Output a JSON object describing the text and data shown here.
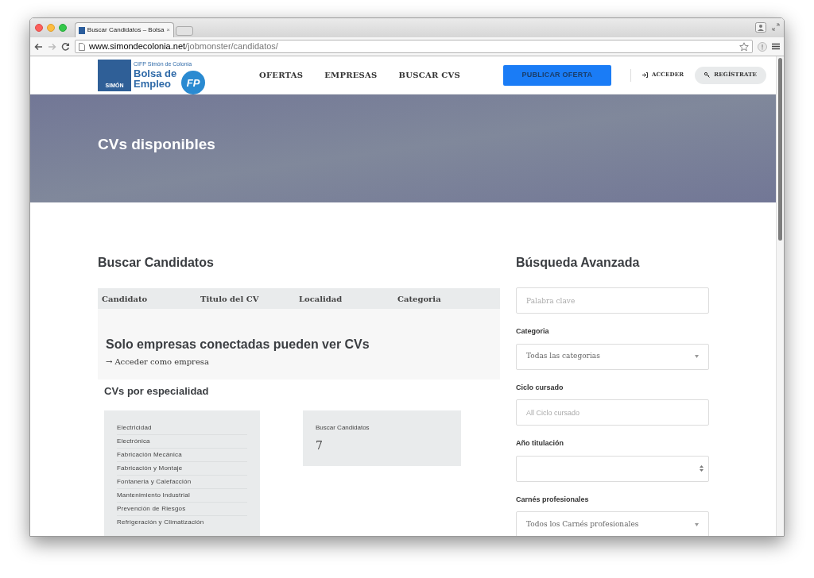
{
  "browser": {
    "tab_title": "Buscar Candidatos – Bolsa",
    "tab_close": "×",
    "url_host": "www.simondecolonia.net",
    "url_path": "/jobmonster/candidatos/"
  },
  "header": {
    "logo": {
      "mark": "SIMÓN",
      "school": "CIFP Simón de Colonia",
      "line1": "Bolsa de",
      "line2": "Empleo",
      "badge": "FP"
    },
    "nav": [
      {
        "label": "OFERTAS",
        "kind": "link"
      },
      {
        "label": "EMPRESAS",
        "kind": "link"
      },
      {
        "label": "BUSCAR CVS",
        "kind": "link"
      },
      {
        "label": "PUBLICAR OFERTA",
        "kind": "primary"
      }
    ],
    "account": [
      {
        "label": "ACCEDER",
        "kind": "plain"
      },
      {
        "label": "REGÍSTRATE",
        "kind": "pill"
      }
    ]
  },
  "hero": {
    "title": "CVs disponibles"
  },
  "main": {
    "title": "Buscar Candidatos",
    "table": {
      "columns": [
        "Candidato",
        "Titulo del CV",
        "Localidad",
        "Categoria"
      ]
    },
    "notice": {
      "title": "Solo empresas conectadas pueden ver CVs",
      "link_arrow": "→",
      "link": "Acceder como empresa"
    },
    "specialties": {
      "title": "CVs por especialidad",
      "items": [
        "Electricidad",
        "Electrónica",
        "Fabricación Mecánica",
        "Fabricación y Montaje",
        "Fontaneria y Calefacción",
        "Mantenimiento Industrial",
        "Prevención de Riesgos",
        "Refrigeración y Climatización"
      ]
    },
    "count_card": {
      "label": "Buscar Candidatos",
      "value": "7"
    }
  },
  "sidebar": {
    "title": "Búsqueda Avanzada",
    "fields": [
      {
        "kind": "text",
        "placeholder": "Palabra clave"
      },
      {
        "kind": "select",
        "label": "Categoria",
        "value": "Todas las categorias"
      },
      {
        "kind": "combo",
        "label": "Ciclo cursado",
        "placeholder": "All Ciclo cursado"
      },
      {
        "kind": "spinner",
        "label": "Año titulación"
      },
      {
        "kind": "select",
        "label": "Carnés profesionales",
        "value": "Todos los Carnés profesionales"
      }
    ]
  }
}
